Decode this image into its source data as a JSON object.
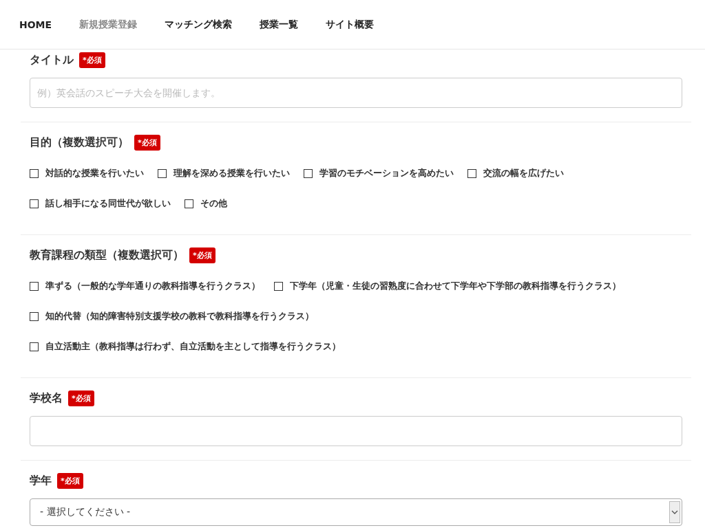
{
  "nav": [
    {
      "label": "HOME",
      "selected": false
    },
    {
      "label": "新規授業登録",
      "selected": true
    },
    {
      "label": "マッチング検索",
      "selected": false
    },
    {
      "label": "授業一覧",
      "selected": false
    },
    {
      "label": "サイト概要",
      "selected": false
    }
  ],
  "sections": [
    {
      "kind": "text",
      "label": "タイトル",
      "badge": "*必須",
      "placeholder": "例）英会話のスピーチ大会を開催します。"
    },
    {
      "kind": "checkboxes",
      "label": "目的（複数選択可）",
      "badge": "*必須",
      "rows": [
        [
          {
            "label": "対話的な授業を行いたい",
            "checked": false
          },
          {
            "label": "理解を深める授業を行いたい",
            "checked": false
          },
          {
            "label": "学習のモチベーションを高めたい",
            "checked": false
          },
          {
            "label": "交流の幅を広げたい",
            "checked": false
          }
        ],
        [
          {
            "label": "話し相手になる同世代が欲しい",
            "checked": false
          },
          {
            "label": "その他",
            "checked": false
          }
        ]
      ]
    },
    {
      "kind": "checkboxes",
      "label": "教育課程の類型（複数選択可）",
      "badge": "*必須",
      "rows": [
        [
          {
            "label": "準ずる（一般的な学年通りの教科指導を行うクラス）",
            "checked": false
          },
          {
            "label": "下学年（児童・生徒の習熟度に合わせて下学年や下学部の教科指導を行うクラス）",
            "checked": false
          }
        ],
        [
          {
            "label": "知的代替（知的障害特別支援学校の教科で教科指導を行うクラス）",
            "checked": false
          }
        ],
        [
          {
            "label": "自立活動主（教科指導は行わず、自立活動を主として指導を行うクラス）",
            "checked": false
          }
        ]
      ]
    },
    {
      "kind": "text",
      "label": "学校名",
      "badge": "*必須"
    },
    {
      "kind": "select",
      "label": "学年",
      "badge": "*必須",
      "value": "- 選択してください -"
    }
  ]
}
